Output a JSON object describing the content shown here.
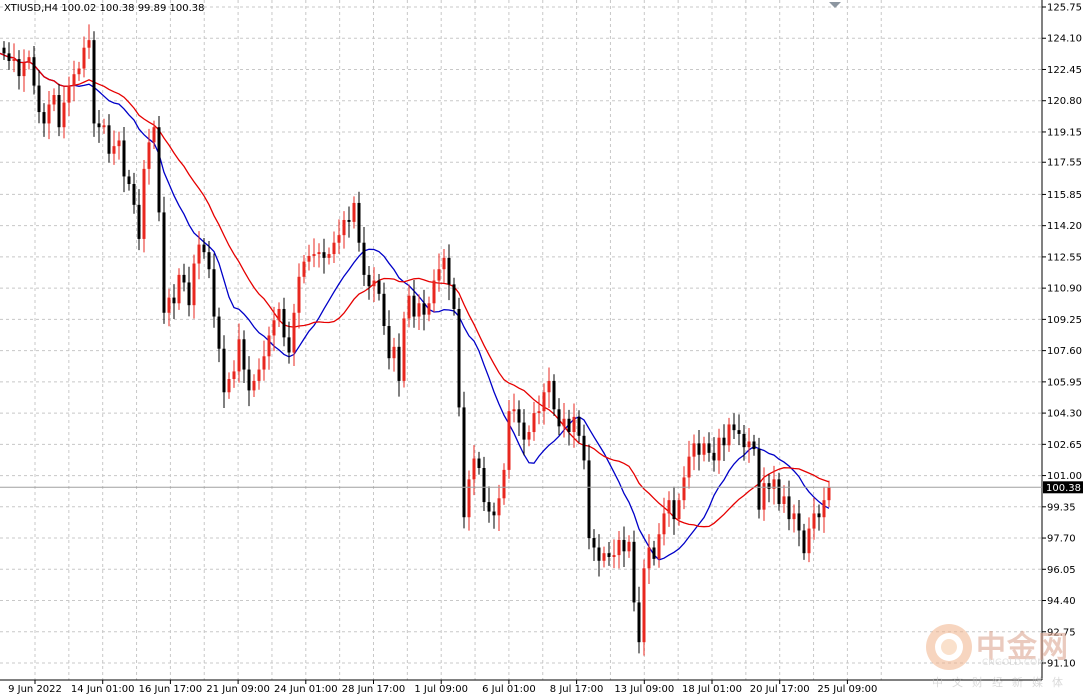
{
  "header": {
    "symbol": "XTIUSD,H4",
    "ohlc": "100.02 100.38 99.89 100.38"
  },
  "watermark": {
    "cn": "中金网",
    "en": "CNGOLD.COM",
    "tag": "中文财经新媒体"
  },
  "colors": {
    "bull": "#e8271f",
    "bear": "#000000",
    "ma_fast": "#0000c8",
    "ma_slow": "#e60000",
    "grid": "#c8c8c8",
    "current_price": "#000000"
  },
  "chart_data": {
    "type": "candlestick",
    "ylim": [
      91.1,
      125.75
    ],
    "y_ticks": [
      "125.75",
      "124.10",
      "122.45",
      "120.80",
      "119.15",
      "117.55",
      "115.85",
      "114.20",
      "112.55",
      "110.90",
      "109.25",
      "107.60",
      "105.95",
      "104.30",
      "102.65",
      "101.00",
      "99.35",
      "97.70",
      "96.05",
      "94.40",
      "92.75",
      "91.10"
    ],
    "x_tick_labels": [
      "9 Jun 2022",
      "14 Jun 01:00",
      "16 Jun 17:00",
      "21 Jun 09:00",
      "24 Jun 01:00",
      "28 Jun 17:00",
      "1 Jul 09:00",
      "6 Jul 01:00",
      "8 Jul 17:00",
      "13 Jul 09:00",
      "18 Jul 01:00",
      "20 Jul 17:00",
      "25 Jul 09:00"
    ],
    "current_price": 100.38,
    "candles_close": [
      123.3,
      122.9,
      123.0,
      122.1,
      122.8,
      123.1,
      121.6,
      120.2,
      119.6,
      120.6,
      121.1,
      119.4,
      120.7,
      121.6,
      122.2,
      122.5,
      123.6,
      124.0,
      119.6,
      119.4,
      119.5,
      118.0,
      118.4,
      118.7,
      116.8,
      116.4,
      115.3,
      113.5,
      117.2,
      118.6,
      119.4,
      114.9,
      109.6,
      110.4,
      110.1,
      111.6,
      111.2,
      110.0,
      112.2,
      113.2,
      112.8,
      111.9,
      109.4,
      107.7,
      105.4,
      106.1,
      106.5,
      108.2,
      106.6,
      105.5,
      106.0,
      106.6,
      107.3,
      108.4,
      109.2,
      109.8,
      108.3,
      107.5,
      109.6,
      111.5,
      112.3,
      112.6,
      112.7,
      112.8,
      112.5,
      112.7,
      113.3,
      113.7,
      114.5,
      114.4,
      115.4,
      113.3,
      111.6,
      111.0,
      111.3,
      110.6,
      108.9,
      107.2,
      107.8,
      106.0,
      109.3,
      110.5,
      109.4,
      110.1,
      109.5,
      110.1,
      111.3,
      111.9,
      112.5,
      111.1,
      109.8,
      104.6,
      98.8,
      100.8,
      101.9,
      101.4,
      99.6,
      99.1,
      98.9,
      99.8,
      101.3,
      104.4,
      104.5,
      103.8,
      102.9,
      103.3,
      104.3,
      104.4,
      105.4,
      106.0,
      104.5,
      103.6,
      104.0,
      103.3,
      104.1,
      103.1,
      101.8,
      97.7,
      97.2,
      96.5,
      96.9,
      96.7,
      96.8,
      97.6,
      97.0,
      97.5,
      94.3,
      92.2,
      96.1,
      97.2,
      96.6,
      97.9,
      99.0,
      99.7,
      98.7,
      99.7,
      100.9,
      102.0,
      102.7,
      102.1,
      102.7,
      102.2,
      101.8,
      103.0,
      102.6,
      103.7,
      103.4,
      103.2,
      102.5,
      102.8,
      102.4,
      99.2,
      100.6,
      100.3,
      100.8,
      99.5,
      99.9,
      98.7,
      99.0,
      98.1,
      96.9,
      98.2,
      99.0,
      98.8,
      99.7,
      100.38
    ]
  }
}
